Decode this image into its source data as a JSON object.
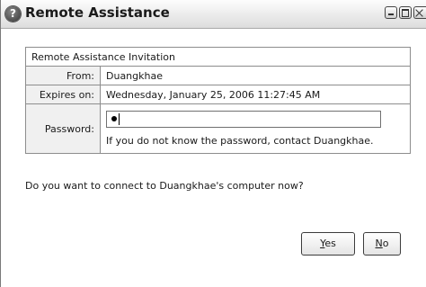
{
  "window": {
    "title": "Remote Assistance",
    "help_glyph": "?",
    "icons": [
      "help-icon",
      "minimize-icon",
      "maximize-icon",
      "close-icon"
    ]
  },
  "invitation": {
    "header": "Remote Assistance Invitation",
    "from_label": "From:",
    "from_value": "Duangkhae",
    "expires_label": "Expires on:",
    "expires_value": "Wednesday, January 25, 2006 11:27:45 AM",
    "password_label": "Password:",
    "password_hint": "If you do not know the password, contact Duangkhae."
  },
  "prompt": {
    "question": "Do you want to connect to Duangkhae's computer now?"
  },
  "buttons": {
    "yes_mnemonic": "Y",
    "yes_rest": "es",
    "no_mnemonic": "N",
    "no_rest": "o"
  }
}
